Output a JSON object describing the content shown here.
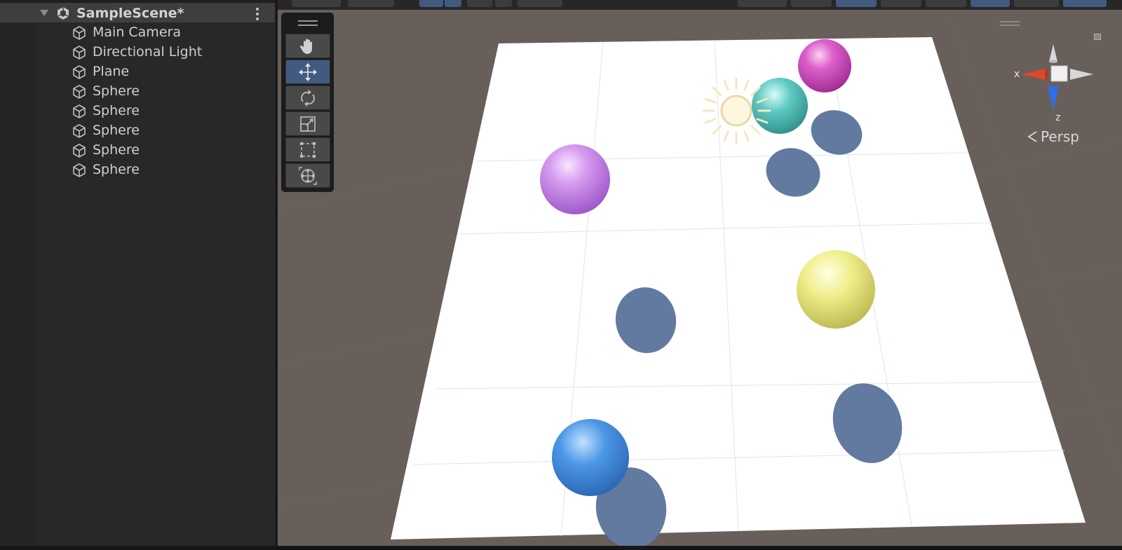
{
  "hierarchy": {
    "scene_name": "SampleScene*",
    "items": [
      {
        "label": "Main Camera"
      },
      {
        "label": "Directional Light"
      },
      {
        "label": "Plane"
      },
      {
        "label": "Sphere"
      },
      {
        "label": "Sphere"
      },
      {
        "label": "Sphere"
      },
      {
        "label": "Sphere"
      },
      {
        "label": "Sphere"
      }
    ]
  },
  "tools": [
    "hand-tool",
    "move-tool",
    "rotate-tool",
    "scale-tool",
    "rect-tool",
    "transform-tool"
  ],
  "active_tool": "move-tool",
  "scene_view": {
    "projection_label": "Persp",
    "gizmo_axis_x": "x",
    "gizmo_axis_z": "z"
  },
  "colors": {
    "panel_bg": "#282828",
    "scene_bg": "#685f5a",
    "active_tool": "#415b80",
    "plane": "#ffffff",
    "shadow": "#627aa0"
  }
}
